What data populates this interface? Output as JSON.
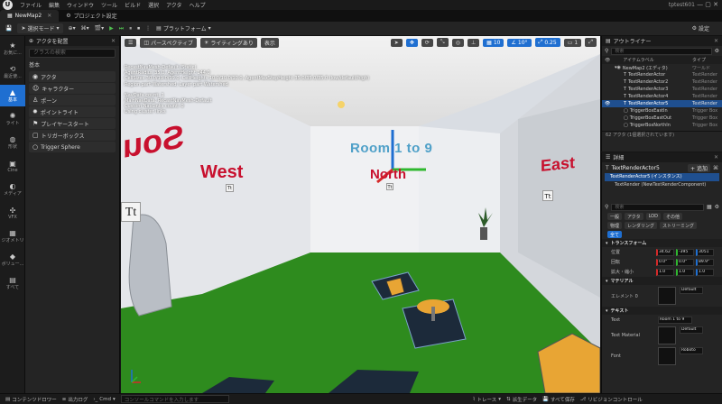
{
  "menu": {
    "items": [
      "ファイル",
      "編集",
      "ウィンドウ",
      "ツール",
      "ビルド",
      "選択",
      "アクタ",
      "ヘルプ"
    ],
    "project": "tptest601"
  },
  "tabs": {
    "map_tab": "NewMap2",
    "project_settings": "プロジェクト設定"
  },
  "toolbar": {
    "select_mode": "選択モード",
    "platform": "プラットフォーム",
    "settings": "設定"
  },
  "rail": [
    {
      "icon": "★",
      "label": "お気に..."
    },
    {
      "icon": "⟲",
      "label": "最近使..."
    },
    {
      "icon": "▲",
      "label": "基本"
    },
    {
      "icon": "✺",
      "label": "ライト"
    },
    {
      "icon": "◍",
      "label": "形状"
    },
    {
      "icon": "▣",
      "label": "Cine"
    },
    {
      "icon": "◐",
      "label": "メディア"
    },
    {
      "icon": "✣",
      "label": "VFX"
    },
    {
      "icon": "▦",
      "label": "ジオメトリ"
    },
    {
      "icon": "◆",
      "label": "ボリュー..."
    },
    {
      "icon": "▤",
      "label": "すべて"
    }
  ],
  "place_panel": {
    "title": "アクタを配置",
    "search_placeholder": "クラスの検索",
    "category": "基本",
    "actors": [
      "アクタ",
      "キャラクター",
      "ポーン",
      "ポイントライト",
      "プレイヤースタート",
      "トリガーボックス",
      "Trigger Sphere"
    ]
  },
  "viewport": {
    "perspective": "パースペクティブ",
    "lighting": "ライティングあり",
    "show": "表示",
    "grid_snap": "10",
    "rot_snap": "10°",
    "scale_snap": "0.25",
    "cam_speed": "1",
    "stats": [
      "RecastNavMesh-Default (Static)",
      "AgentRadius 35.0, AgentHeight 144.0",
      "CellSizes 30.0/19.0/19.0, CellHeights 10.0/10.0/10.0, AgentMaxStepHeight 35.0/35.0/35.0 (low/default/high)",
      "Region part Watershed, Layer part Watershed",
      "",
      "NavData count: 1",
      "MainNavData: RecastNavMesh-Default",
      "Custom NavLinks count: 0",
      "Using cluster links"
    ],
    "scene": {
      "room_label": "Room 1 to 9",
      "west": "West",
      "north": "North",
      "east": "East",
      "left_sign": "Sou",
      "text_icon": "Tt"
    }
  },
  "outliner": {
    "title": "アウトライナー",
    "search_placeholder": "検索",
    "col_label": "アイテムラベル",
    "col_type": "タイプ",
    "rows": [
      {
        "label": "NewMap2 (エディタ)",
        "type": "ワールド"
      },
      {
        "label": "TextRenderActor",
        "type": "TextRender"
      },
      {
        "label": "TextRenderActor2",
        "type": "TextRender"
      },
      {
        "label": "TextRenderActor3",
        "type": "TextRender"
      },
      {
        "label": "TextRenderActor4",
        "type": "TextRender"
      },
      {
        "label": "TextRenderActor5",
        "type": "TextRender"
      },
      {
        "label": "TriggerBoxEastIn",
        "type": "Trigger Box"
      },
      {
        "label": "TriggerBoxEastOut",
        "type": "Trigger Box"
      },
      {
        "label": "TriggerBoxNorthIn",
        "type": "Trigger Box"
      }
    ],
    "count": "62 アクタ (1個選択されています)"
  },
  "details": {
    "title": "詳細",
    "actor_name": "TextRenderActor5",
    "add_button": "+ 追加",
    "component_root": "TextRenderActor5 (インスタンス)",
    "component_child": "TextRender (NewTextRenderComponent)",
    "search_placeholder": "検索",
    "filters_row1": [
      "一般",
      "アクタ",
      "LOD",
      "その他"
    ],
    "filters_row2": [
      "物理",
      "レンダリング",
      "ストリーミング"
    ],
    "filter_all": "全て",
    "transform": {
      "section": "トランスフォーム",
      "location_label": "位置",
      "location": [
        "34.62",
        "-395",
        "3051"
      ],
      "rotation_label": "回転",
      "rotation": [
        "0.0°",
        "0.0°",
        "89.9°"
      ],
      "scale_label": "拡大・縮小",
      "scale": [
        "1.0",
        "1.0",
        "1.0"
      ]
    },
    "material": {
      "section": "マテリアル",
      "element_label": "エレメント 0",
      "element_value": "Default"
    },
    "text": {
      "section": "テキスト",
      "text_label": "Text",
      "text_value": "Room 1 to 9",
      "text_material_label": "Text Material",
      "text_material_value": "Default",
      "font_label": "Font",
      "font_value": "Roboto"
    }
  },
  "statusbar": {
    "content_drawer": "コンテンツドロワー",
    "output_log": "出力ログ",
    "cmd": "Cmd",
    "console_placeholder": "コンソールコマンドを入力します",
    "trace": "トレース",
    "derived_data": "派生データ",
    "save_all": "すべて保存",
    "source_control": "リビジョンコントロール"
  },
  "colors": {
    "accent": "#1f6fd1",
    "sign_red": "#c8102e",
    "floor_green": "#2e8b1e",
    "room_text": "#4fa0c8"
  }
}
